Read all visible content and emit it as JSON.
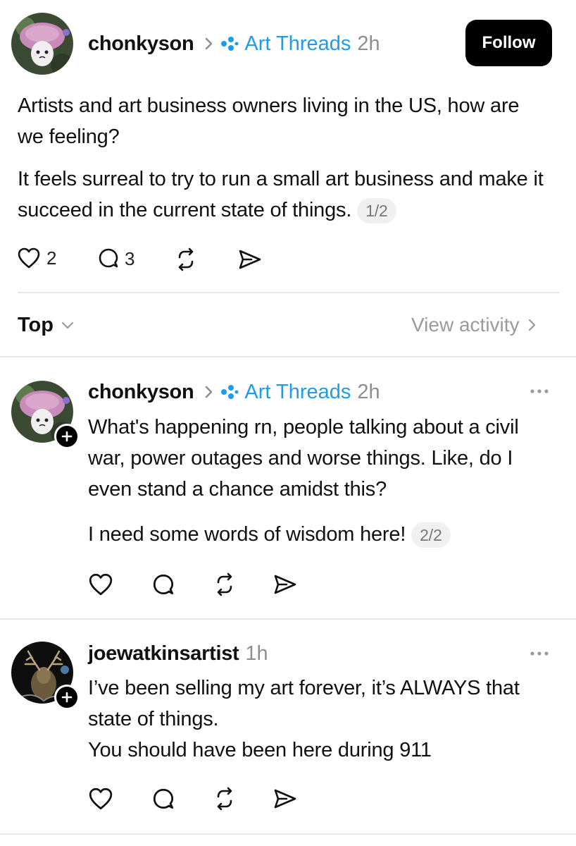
{
  "post": {
    "username": "chonkyson",
    "topic": "Art Threads",
    "time": "2h",
    "follow_label": "Follow",
    "paragraph1": "Artists and art business owners living in the US, how are we feeling?",
    "paragraph2": "It feels surreal to try to run a small art business and make it succeed in the current state of things.",
    "counter": "1/2",
    "likes": "2",
    "replies": "3"
  },
  "sort": {
    "label": "Top",
    "view_activity": "View activity"
  },
  "replies": [
    {
      "username": "chonkyson",
      "topic": "Art Threads",
      "time": "2h",
      "paragraph1": "What's happening rn, people talking about a civil war, power outages and worse things. Like, do I even stand a chance amidst this?",
      "paragraph2": "I need some words of wisdom here!",
      "counter": "2/2"
    },
    {
      "username": "joewatkinsartist",
      "time": "1h",
      "line1": "I’ve been selling my art forever, it’s ALWAYS that state of things.",
      "line2": "You should have been here during 911"
    }
  ],
  "icons": {
    "more": "more-horizontal-icon",
    "chevron": "chevron-right-icon",
    "plus": "plus-icon"
  },
  "colors": {
    "topic": "#1d9bf0",
    "meta_gray": "#8e8e8e",
    "follow_bg": "#000000"
  }
}
